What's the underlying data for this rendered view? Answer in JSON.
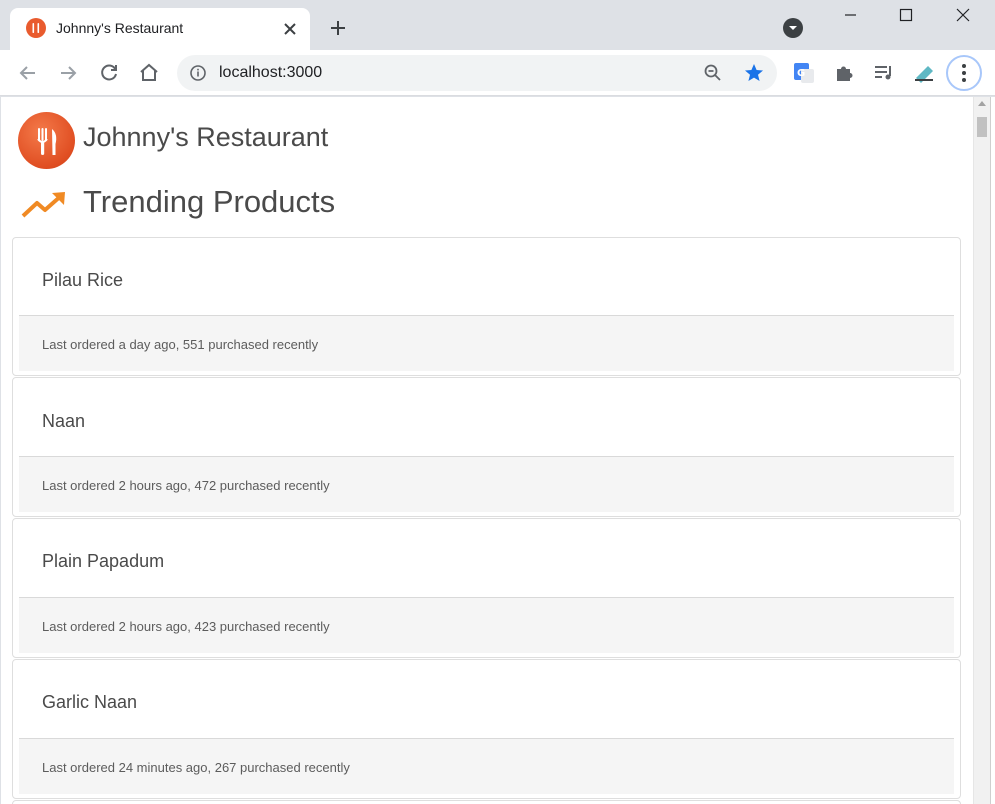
{
  "browser": {
    "tab_title": "Johnny's Restaurant",
    "url": "localhost:3000",
    "accent_color": "#1a73e8"
  },
  "header": {
    "brand_name": "Johnny's Restaurant",
    "brand_color": "#e95b2e"
  },
  "section": {
    "title": "Trending Products",
    "icon": "trending-up-icon",
    "icon_color": "#f08a24"
  },
  "products": [
    {
      "name": "Pilau Rice",
      "meta": "Last ordered a day ago, 551 purchased recently"
    },
    {
      "name": "Naan",
      "meta": "Last ordered 2 hours ago, 472 purchased recently"
    },
    {
      "name": "Plain Papadum",
      "meta": "Last ordered 2 hours ago, 423 purchased recently"
    },
    {
      "name": "Garlic Naan",
      "meta": "Last ordered 24 minutes ago, 267 purchased recently"
    }
  ]
}
